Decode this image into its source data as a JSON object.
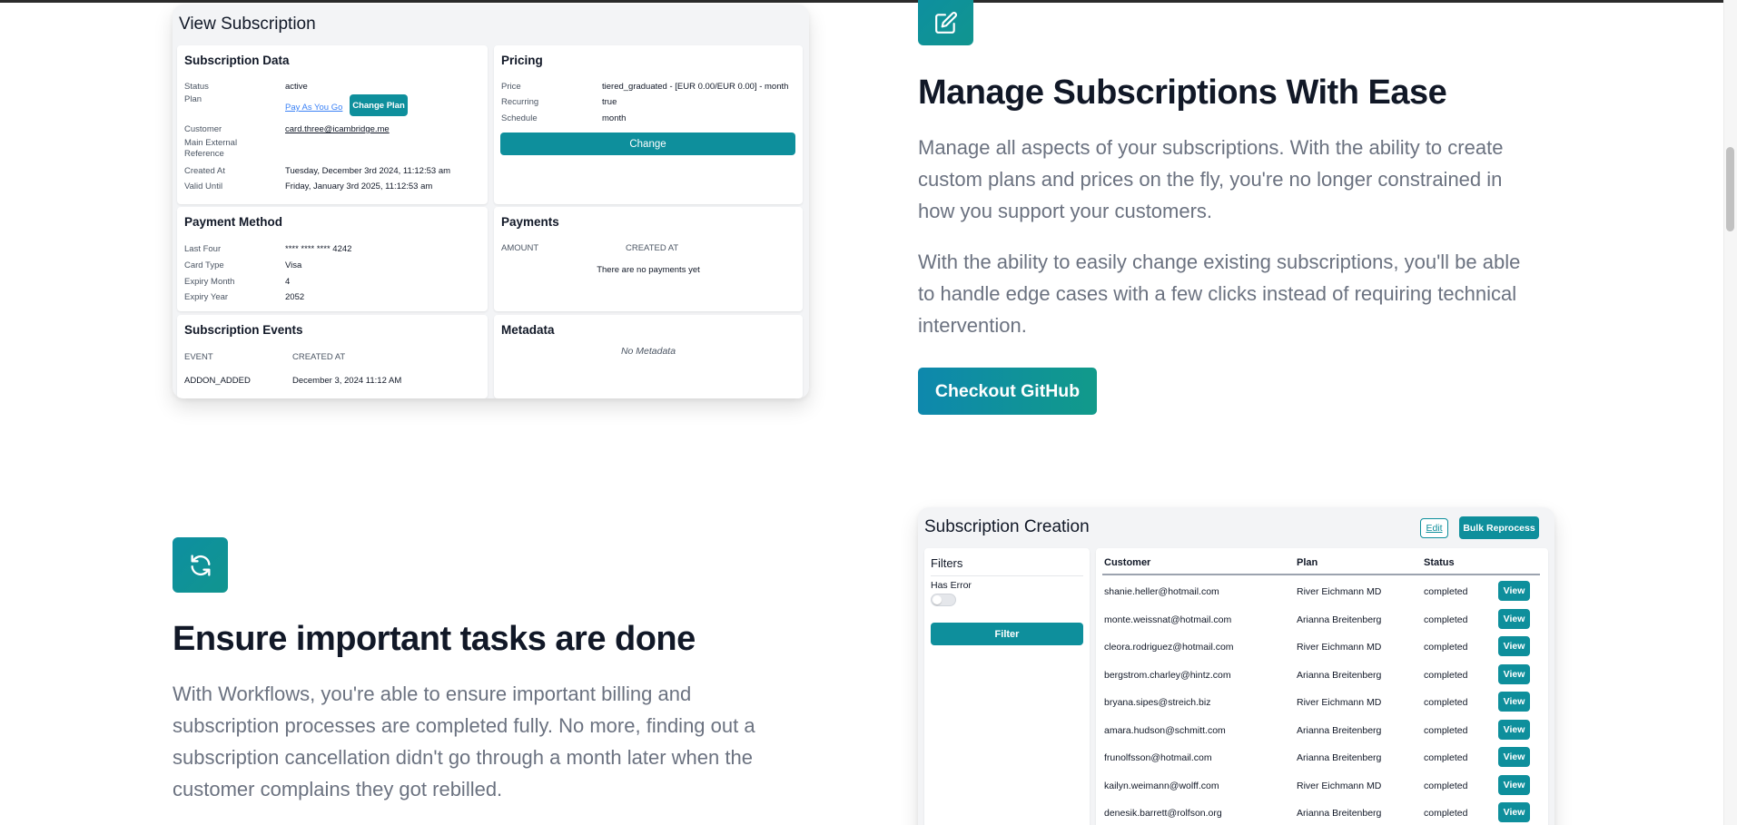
{
  "view_subscription": {
    "title": "View Subscription",
    "subscription_data": {
      "title": "Subscription Data",
      "status_label": "Status",
      "status_value": "active",
      "plan_label": "Plan",
      "plan_value": "Pay As You Go",
      "change_plan_label": "Change Plan",
      "customer_label": "Customer",
      "customer_value": "card.three@icambridge.me",
      "ext_ref_label_1": "Main External",
      "ext_ref_label_2": "Reference",
      "created_label": "Created At",
      "created_value": "Tuesday, December 3rd 2024, 11:12:53 am",
      "valid_label": "Valid Until",
      "valid_value": "Friday, January 3rd 2025, 11:12:53 am"
    },
    "pricing": {
      "title": "Pricing",
      "price_label": "Price",
      "price_value": "tiered_graduated - [EUR 0.00/EUR 0.00] - month",
      "recurring_label": "Recurring",
      "recurring_value": "true",
      "schedule_label": "Schedule",
      "schedule_value": "month",
      "change_label": "Change"
    },
    "payment_method": {
      "title": "Payment Method",
      "last_four_label": "Last Four",
      "last_four_value": "**** **** **** 4242",
      "card_type_label": "Card Type",
      "card_type_value": "Visa",
      "expiry_month_label": "Expiry Month",
      "expiry_month_value": "4",
      "expiry_year_label": "Expiry Year",
      "expiry_year_value": "2052"
    },
    "payments": {
      "title": "Payments",
      "col_amount": "AMOUNT",
      "col_created": "CREATED AT",
      "empty": "There are no payments yet"
    },
    "events": {
      "title": "Subscription Events",
      "col_event": "EVENT",
      "col_created": "CREATED AT",
      "event_name": "ADDON_ADDED",
      "event_date": "December 3, 2024 11:12 AM"
    },
    "metadata": {
      "title": "Metadata",
      "empty": "No Metadata"
    }
  },
  "feature_manage": {
    "icon": "edit-icon",
    "heading": "Manage Subscriptions With Ease",
    "para1_l1": "Manage all aspects of your subscriptions. With the ability to create",
    "para1_l2": "custom plans and prices on the fly, you're no longer constrained in",
    "para1_l3": "how you support your customers.",
    "para2_l1": "With the ability to easily change existing subscriptions, you'll be able",
    "para2_l2": "to handle edge cases with a few clicks instead of requiring technical",
    "para2_l3": "intervention.",
    "cta_label": "Checkout GitHub"
  },
  "feature_workflows": {
    "icon": "refresh-icon",
    "heading": "Ensure important tasks are done",
    "para_l1": "With Workflows, you're able to ensure important billing and",
    "para_l2": "subscription processes are completed fully. No more, finding out a",
    "para_l3": "subscription cancellation didn't go through a month later when the",
    "para_l4": "customer complains they got rebilled."
  },
  "subscription_creation": {
    "title": "Subscription Creation",
    "edit_label": "Edit",
    "bulk_label": "Bulk Reprocess",
    "filters_title": "Filters",
    "has_error_label": "Has Error",
    "filter_button": "Filter",
    "col_customer": "Customer",
    "col_plan": "Plan",
    "col_status": "Status",
    "view_label": "View",
    "rows": [
      {
        "customer": "shanie.heller@hotmail.com",
        "plan": "River Eichmann MD",
        "status": "completed"
      },
      {
        "customer": "monte.weissnat@hotmail.com",
        "plan": "Arianna Breitenberg",
        "status": "completed"
      },
      {
        "customer": "cleora.rodriguez@hotmail.com",
        "plan": "River Eichmann MD",
        "status": "completed"
      },
      {
        "customer": "bergstrom.charley@hintz.com",
        "plan": "Arianna Breitenberg",
        "status": "completed"
      },
      {
        "customer": "bryana.sipes@streich.biz",
        "plan": "River Eichmann MD",
        "status": "completed"
      },
      {
        "customer": "amara.hudson@schmitt.com",
        "plan": "Arianna Breitenberg",
        "status": "completed"
      },
      {
        "customer": "frunolfsson@hotmail.com",
        "plan": "Arianna Breitenberg",
        "status": "completed"
      },
      {
        "customer": "kailyn.weimann@wolff.com",
        "plan": "River Eichmann MD",
        "status": "completed"
      },
      {
        "customer": "denesik.barrett@rolfson.org",
        "plan": "Arianna Breitenberg",
        "status": "completed"
      }
    ]
  }
}
